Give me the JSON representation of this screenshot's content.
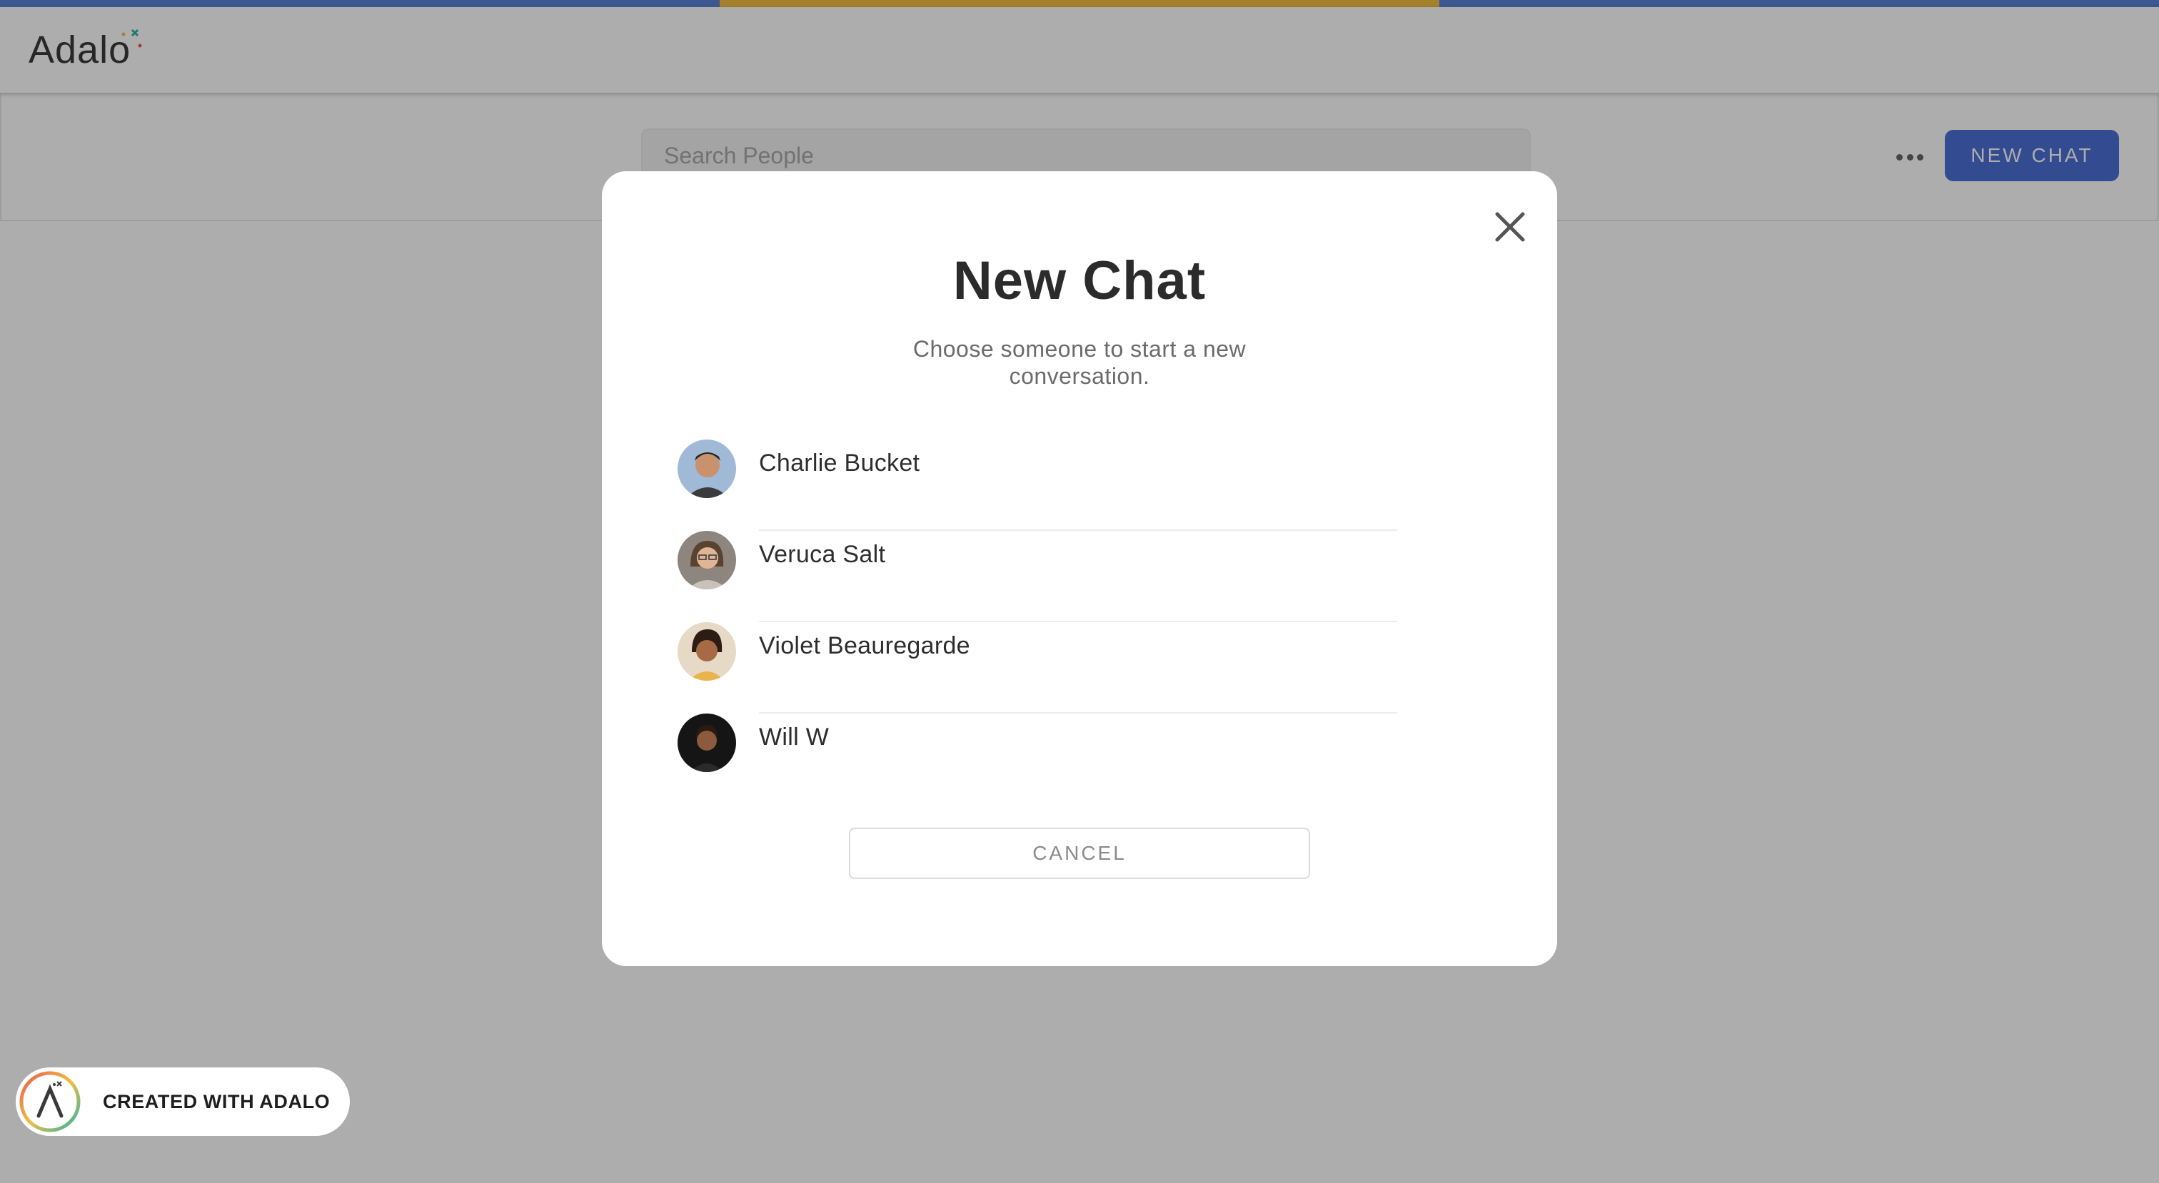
{
  "app": {
    "brand": "Adalo",
    "strip_colors": [
      "#5b82d6",
      "#f3bf44",
      "#5b82d6"
    ]
  },
  "toolbar": {
    "search_placeholder": "Search People",
    "more_icon": "more-horizontal-icon",
    "new_chat_label": "NEW CHAT"
  },
  "modal": {
    "title": "New Chat",
    "subtitle": "Choose someone to start a new conversation.",
    "close_icon": "close-icon",
    "people": [
      {
        "name": "Charlie Bucket",
        "avatar_color": "#8aa6c4"
      },
      {
        "name": "Veruca Salt",
        "avatar_color": "#9a8f86"
      },
      {
        "name": "Violet Beauregarde",
        "avatar_color": "#d9c6ae"
      },
      {
        "name": "Will W",
        "avatar_color": "#1a1a1a"
      }
    ],
    "cancel_label": "CANCEL"
  },
  "badge": {
    "label": "CREATED WITH ADALO"
  },
  "colors": {
    "accent": "#4a6fd6",
    "overlay": "rgba(0,0,0,0.32)"
  }
}
